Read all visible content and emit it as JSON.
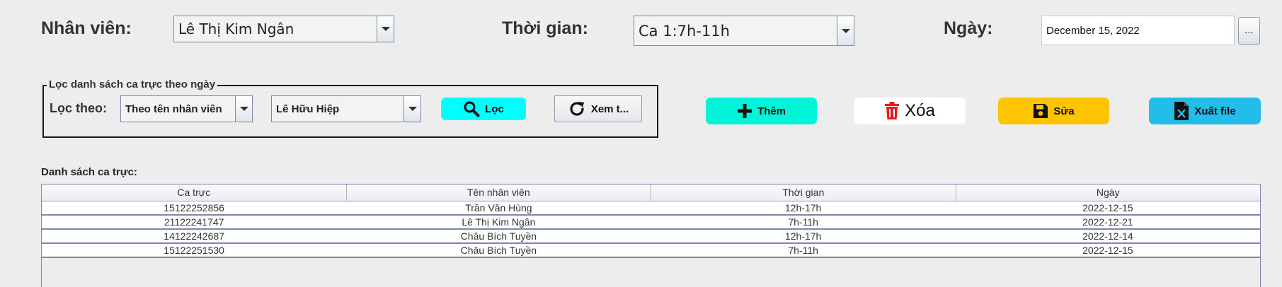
{
  "header": {
    "employee_label": "Nhân viên:",
    "employee_value": "Lê Thị Kim Ngân",
    "time_label": "Thời gian:",
    "time_value": "Ca 1:7h-11h",
    "date_label": "Ngày:",
    "date_value": "December 15, 2022",
    "date_button": "..."
  },
  "filter": {
    "group_title": "Lọc danh sách ca trực theo ngày",
    "by_label": "Lọc theo:",
    "by_value": "Theo tên nhân viên",
    "name_value": "Lê Hữu Hiệp",
    "filter_button": "Lọc",
    "view_button": "Xem t..."
  },
  "actions": {
    "add_label": "Thêm",
    "delete_label": "Xóa",
    "edit_label": "Sửa",
    "export_label": "Xuất file"
  },
  "colors": {
    "filter_button": "#00ffff",
    "add_button": "#00f5d8",
    "delete_button": "#ffffff",
    "delete_icon": "#e81b1b",
    "edit_button": "#ffc400",
    "export_button": "#22bde8"
  },
  "icons": {
    "filter_button": "search-icon",
    "view_button": "refresh-icon",
    "add_button": "plus-icon",
    "delete_button": "trash-icon",
    "edit_button": "save-icon",
    "export_button": "excel-file-icon"
  },
  "list": {
    "title": "Danh sách ca trực:",
    "columns": [
      "Ca trực",
      "Tên nhân viên",
      "Thời gian",
      "Ngày"
    ],
    "rows": [
      [
        "15122252856",
        "Trần Văn Hùng",
        "12h-17h",
        "2022-12-15"
      ],
      [
        "21122241747",
        "Lê Thị Kim Ngân",
        "7h-11h",
        "2022-12-21"
      ],
      [
        "14122242687",
        "Châu Bích Tuyền",
        "12h-17h",
        "2022-12-14"
      ],
      [
        "15122251530",
        "Châu Bích Tuyền",
        "7h-11h",
        "2022-12-15"
      ]
    ]
  }
}
